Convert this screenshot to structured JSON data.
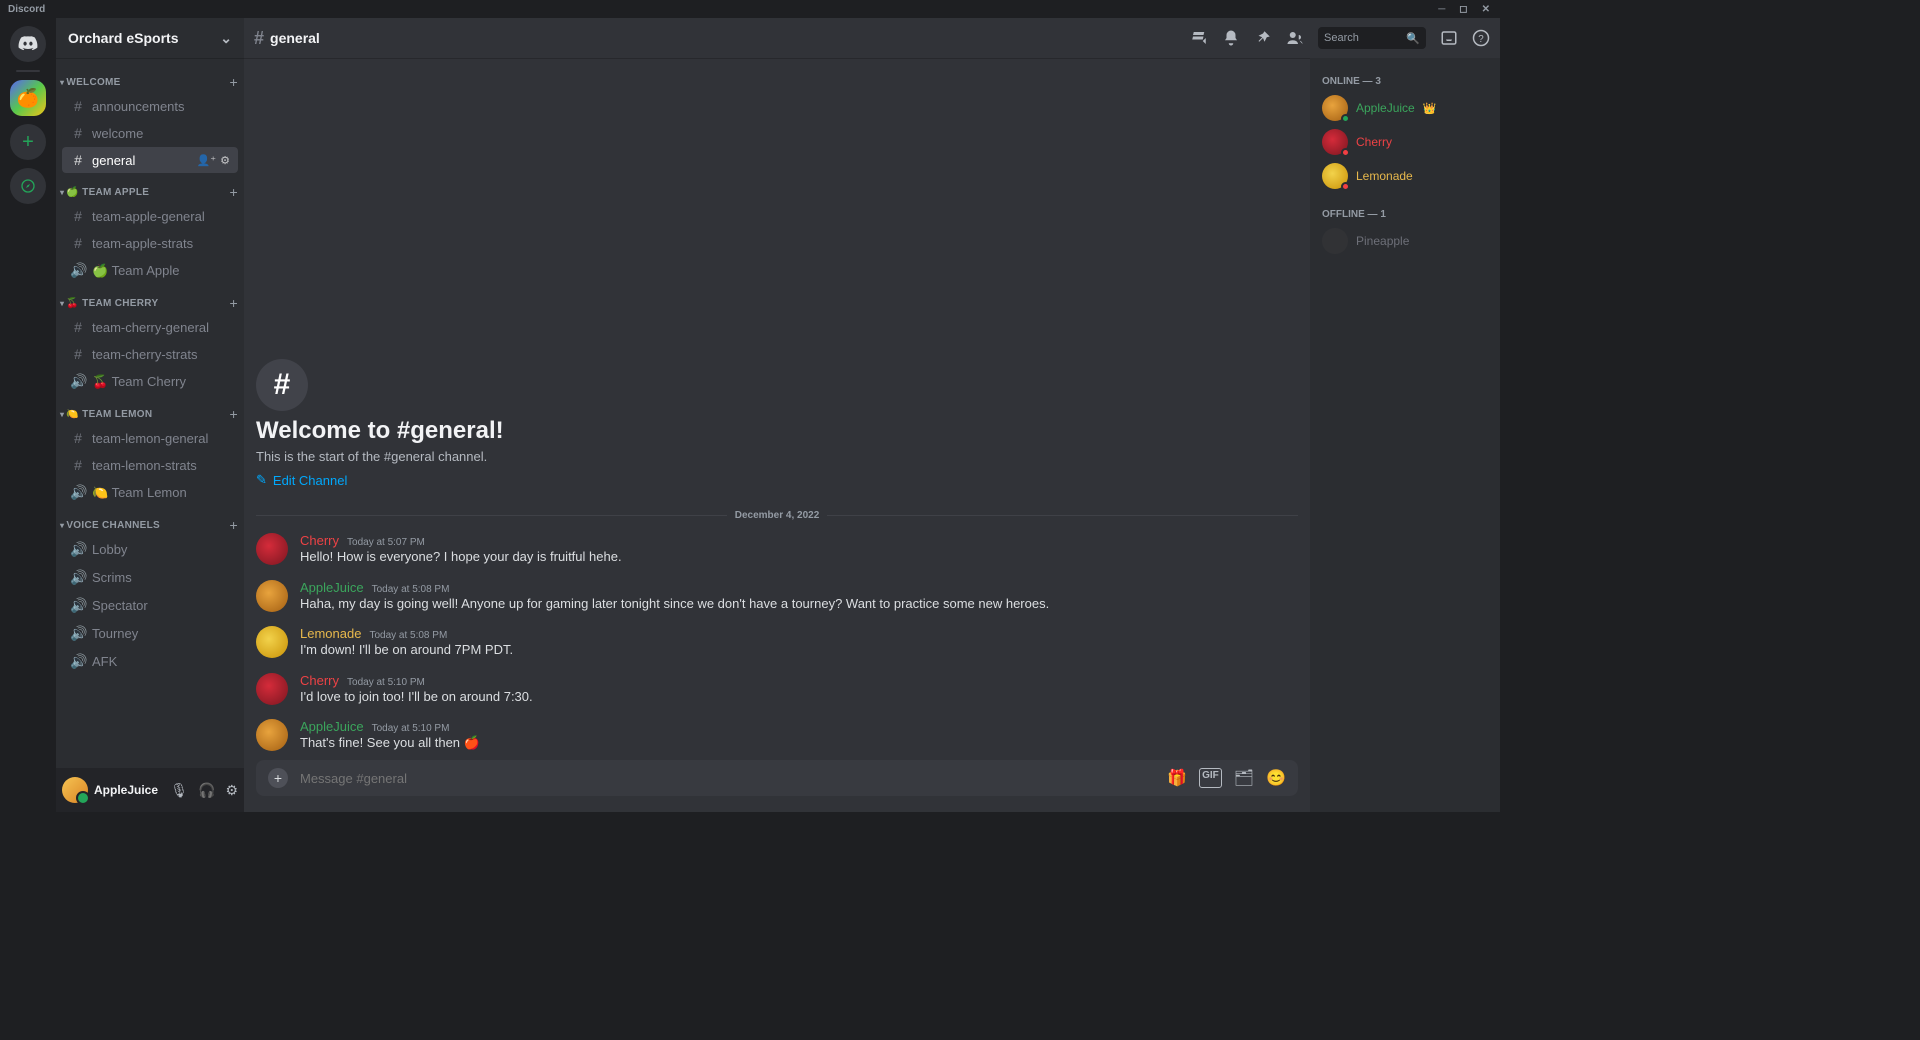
{
  "titlebar": {
    "label": "Discord"
  },
  "server": {
    "name": "Orchard eSports"
  },
  "categories": [
    {
      "label": "WELCOME",
      "channels": [
        {
          "type": "text",
          "name": "announcements"
        },
        {
          "type": "text",
          "name": "welcome"
        },
        {
          "type": "text",
          "name": "general",
          "active": true
        }
      ]
    },
    {
      "label": "🍏 TEAM APPLE",
      "channels": [
        {
          "type": "text",
          "name": "team-apple-general"
        },
        {
          "type": "text",
          "name": "team-apple-strats"
        },
        {
          "type": "voice",
          "name": "🍏 Team Apple"
        }
      ]
    },
    {
      "label": "🍒 TEAM CHERRY",
      "channels": [
        {
          "type": "text",
          "name": "team-cherry-general"
        },
        {
          "type": "text",
          "name": "team-cherry-strats"
        },
        {
          "type": "voice",
          "name": "🍒 Team Cherry"
        }
      ]
    },
    {
      "label": "🍋 TEAM LEMON",
      "channels": [
        {
          "type": "text",
          "name": "team-lemon-general"
        },
        {
          "type": "text",
          "name": "team-lemon-strats"
        },
        {
          "type": "voice",
          "name": "🍋 Team Lemon"
        }
      ]
    },
    {
      "label": "VOICE CHANNELS",
      "channels": [
        {
          "type": "voice",
          "name": "Lobby"
        },
        {
          "type": "voice",
          "name": "Scrims"
        },
        {
          "type": "voice",
          "name": "Spectator"
        },
        {
          "type": "voice",
          "name": "Tourney"
        },
        {
          "type": "voice",
          "name": "AFK"
        }
      ]
    }
  ],
  "self": {
    "name": "AppleJuice"
  },
  "channel": {
    "name": "general",
    "welcome_title": "Welcome to #general!",
    "welcome_sub": "This is the start of the #general channel.",
    "edit_label": "Edit Channel"
  },
  "search_placeholder": "Search",
  "composer_placeholder": "Message #general",
  "date_divider": "December 4, 2022",
  "messages": [
    {
      "author": "Cherry",
      "color": "c-cherry",
      "av": "av-cherry",
      "ts": "Today at 5:07 PM",
      "body": "Hello! How is everyone? I hope your day is fruitful hehe."
    },
    {
      "author": "AppleJuice",
      "color": "c-apple",
      "av": "av-apple",
      "ts": "Today at 5:08 PM",
      "body": "Haha, my day is going well! Anyone up for gaming later tonight since we don't have a tourney? Want to practice some new heroes."
    },
    {
      "author": "Lemonade",
      "color": "c-lemon",
      "av": "av-lemon",
      "ts": "Today at 5:08 PM",
      "body": "I'm down! I'll be on around 7PM PDT."
    },
    {
      "author": "Cherry",
      "color": "c-cherry",
      "av": "av-cherry",
      "ts": "Today at 5:10 PM",
      "body": "I'd love to join too! I'll be on around 7:30."
    },
    {
      "author": "AppleJuice",
      "color": "c-apple",
      "av": "av-apple",
      "ts": "Today at 5:10 PM",
      "body": "That's fine! See you all then 🍎"
    }
  ],
  "members": {
    "online_label": "ONLINE — 3",
    "offline_label": "OFFLINE — 1",
    "online": [
      {
        "name": "AppleJuice",
        "color": "c-apple",
        "av": "av-apple",
        "status": "st-on",
        "owner": true
      },
      {
        "name": "Cherry",
        "color": "c-cherry",
        "av": "av-cherry",
        "status": "st-dnd"
      },
      {
        "name": "Lemonade",
        "color": "c-lemon",
        "av": "av-lemon",
        "status": "st-dnd"
      }
    ],
    "offline": [
      {
        "name": "Pineapple",
        "av": "av-pine"
      }
    ]
  }
}
